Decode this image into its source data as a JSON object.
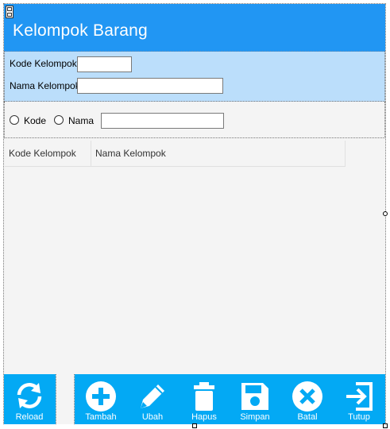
{
  "header": {
    "title": "Kelompok Barang"
  },
  "form": {
    "kode_label": "Kode Kelompok",
    "kode_value": "",
    "nama_label": "Nama Kelompok",
    "nama_value": ""
  },
  "search": {
    "option_kode": "Kode",
    "option_nama": "Nama",
    "value": ""
  },
  "grid": {
    "columns": [
      "Kode Kelompok",
      "Nama Kelompok"
    ]
  },
  "toolbar": {
    "buttons": [
      {
        "label": "Reload",
        "icon": "reload-icon"
      },
      {
        "label": "Tambah",
        "icon": "plus-circle-icon"
      },
      {
        "label": "Ubah",
        "icon": "pencil-icon"
      },
      {
        "label": "Hapus",
        "icon": "trash-icon"
      },
      {
        "label": "Simpan",
        "icon": "save-icon"
      },
      {
        "label": "Batal",
        "icon": "cancel-circle-icon"
      },
      {
        "label": "Tutup",
        "icon": "exit-icon"
      }
    ]
  },
  "colors": {
    "header": "#2196f3",
    "form_panel": "#bbdefb",
    "toolbar": "#03a9f4",
    "background": "#f4f4f4"
  }
}
